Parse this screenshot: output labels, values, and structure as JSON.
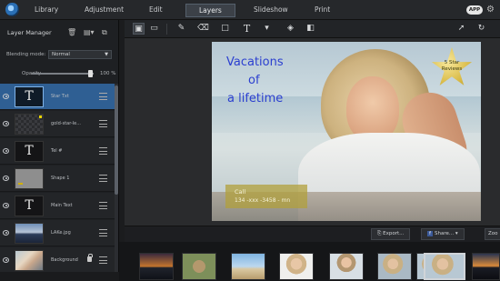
{
  "menu": {
    "tabs": [
      "Library",
      "Adjustment",
      "Edit",
      "Layers",
      "Slideshow",
      "Print"
    ],
    "active_tab": "Layers",
    "app_badge": "APP"
  },
  "layer_manager": {
    "title": "Layer Manager",
    "blending_label": "Blending mode:",
    "blending_value": "Normal",
    "opacity_label": "Opacity",
    "opacity_value": "100 %",
    "opacity_fraction": 1.0,
    "layers": [
      {
        "name": "Star Txt",
        "thumb": "text",
        "selected": true
      },
      {
        "name": "gold-star-le...",
        "thumb": "pattern",
        "selected": false
      },
      {
        "name": "Tel #",
        "thumb": "text",
        "selected": false
      },
      {
        "name": "Shape 1",
        "thumb": "shape",
        "selected": false
      },
      {
        "name": "Main Text",
        "thumb": "text",
        "selected": false
      },
      {
        "name": "LAKe.jpg",
        "thumb": "sunset",
        "selected": false
      },
      {
        "name": "Background",
        "thumb": "photo",
        "selected": false,
        "locked": true
      }
    ]
  },
  "toolbar": {
    "tools": [
      "crop-tool-icon",
      "image-tool-icon",
      "brush-icon",
      "eraser-icon",
      "rectangle-icon",
      "text-tool-icon",
      "dropdown-icon",
      "fill-icon",
      "gradient-icon",
      "pointer-icon",
      "rotate-icon"
    ]
  },
  "canvas": {
    "title_line1": "Vacations",
    "title_line2": "of",
    "title_line3": "a lifetime",
    "badge_line1": "5 Star",
    "badge_line2": "Reviews",
    "call_label": "Call",
    "call_number": "134 -xxx -3458 - mn"
  },
  "actions": {
    "export_label": "Export...",
    "share_label": "Share...",
    "zoom_label": "Zoo"
  },
  "filmstrip": {
    "items": [
      "sunset",
      "cat",
      "beach",
      "woman",
      "woman",
      "woman",
      "woman",
      "woman-selected",
      "sunset"
    ]
  },
  "colors": {
    "accent_selected": "#2f5f93",
    "title_text": "#2b3fd0",
    "badge_gold": "#d8b944"
  }
}
